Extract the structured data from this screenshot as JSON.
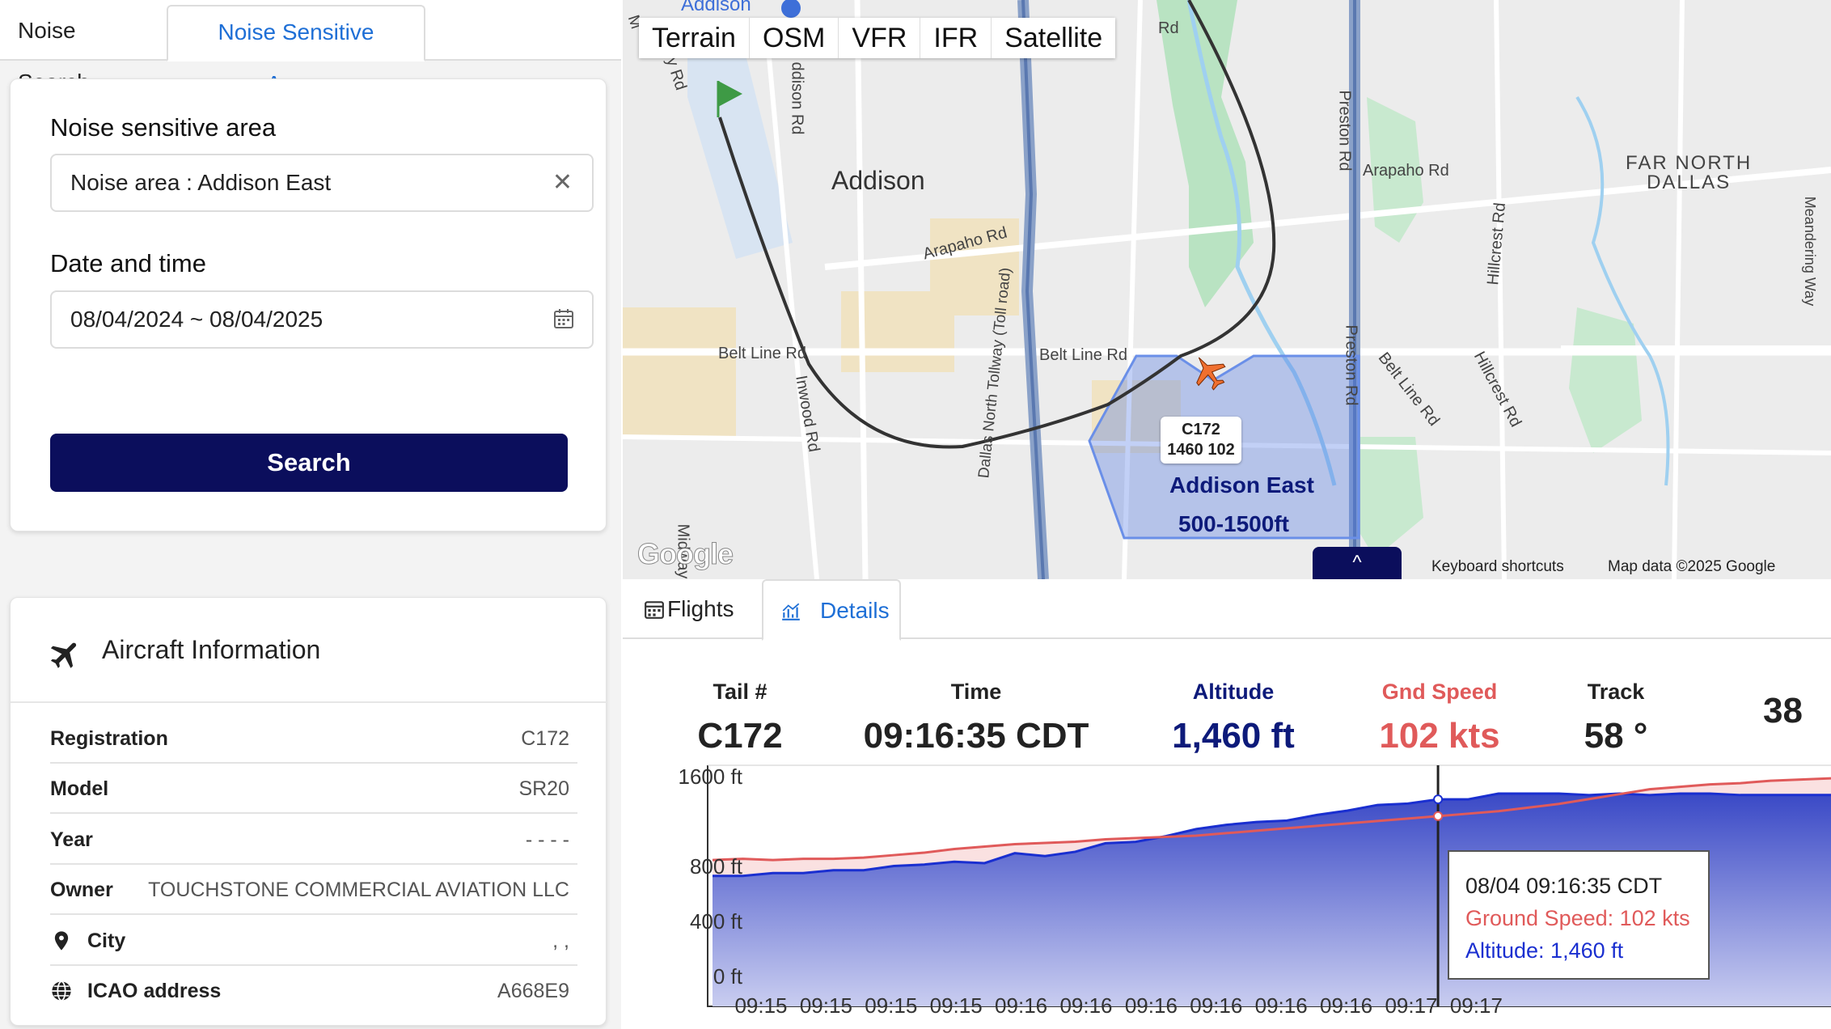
{
  "top_tabs": [
    "Noise Search",
    "Noise Sensitive Areas"
  ],
  "search": {
    "area_label": "Noise sensitive area",
    "area_value": "Noise area : Addison East",
    "date_label": "Date and time",
    "date_value": "08/04/2024 ~ 08/04/2025",
    "button": "Search"
  },
  "aircraft": {
    "title": "Aircraft Information",
    "rows": [
      {
        "k": "Registration",
        "v": "C172"
      },
      {
        "k": "Model",
        "v": "SR20"
      },
      {
        "k": "Year",
        "v": "- - - -"
      },
      {
        "k": "Owner",
        "v": "TOUCHSTONE COMMERCIAL AVIATION LLC"
      },
      {
        "k": "City",
        "v": ", ,"
      },
      {
        "k": "ICAO address",
        "v": "A668E9"
      }
    ]
  },
  "map": {
    "types": [
      "Terrain",
      "OSM",
      "VFR",
      "IFR",
      "Satellite"
    ],
    "labels": {
      "addison_airport": "Addison",
      "addison": "Addison",
      "far_north_dallas_1": "FAR NORTH",
      "far_north_dallas_2": "DALLAS",
      "arapaho_rd_1": "Arapaho Rd",
      "arapaho_rd_2": "Arapaho Rd",
      "belt_line_rd_1": "Belt Line Rd",
      "belt_line_rd_2": "Belt Line Rd",
      "belt_line_rd_3": "Belt Line Rd",
      "preston_rd_1": "Preston Rd",
      "preston_rd_2": "Preston Rd",
      "inwood_rd": "Inwood Rd",
      "addison_rd": "ddison Rd",
      "dallas_tollway_1": "Dallas North Tollway (Toll road)",
      "hillcrest_rd_1": "Hillcrest Rd",
      "hillcrest_rd_2": "Hillcrest Rd",
      "midway_rd": "Midway",
      "meandering_way": "Meandering Way",
      "rd_top": "Rd",
      "rd_top_left": "y Rd",
      "m_top_left": "M"
    },
    "aircraft_tag_1": "C172",
    "aircraft_tag_2": "1460 102",
    "area_name": "Addison East",
    "area_alt": "500-1500ft",
    "keyboard": "Keyboard shortcuts",
    "mapdata": "Map data ©2025 Google",
    "google": "Google",
    "collapse_glyph": "^"
  },
  "detail_tabs": [
    "Flights",
    "Details"
  ],
  "stats": [
    {
      "label": "Tail #",
      "value": "C172"
    },
    {
      "label": "Time",
      "value": "09:16:35 CDT"
    },
    {
      "label": "Altitude",
      "value": "1,460 ft"
    },
    {
      "label": "Gnd Speed",
      "value": "102 kts"
    },
    {
      "label": "Track",
      "value": "58 °"
    },
    {
      "label": "",
      "value": "38"
    }
  ],
  "tooltip": {
    "time": "08/04 09:16:35 CDT",
    "speed": "Ground Speed: 102 kts",
    "alt": "Altitude: 1,460 ft"
  },
  "chart_data": {
    "type": "area",
    "y_ticks": [
      "1600 ft",
      "800 ft",
      "400 ft",
      "0 ft"
    ],
    "ylim": [
      0,
      1700
    ],
    "x_ticks": [
      "09:15",
      "09:15",
      "09:15",
      "09:15",
      "09:16",
      "09:16",
      "09:16",
      "09:16",
      "09:16",
      "09:16",
      "09:17",
      "09:17"
    ],
    "series": [
      {
        "name": "Altitude",
        "color": "#1a2fd0",
        "values": [
          920,
          920,
          940,
          940,
          960,
          960,
          990,
          1000,
          1020,
          1010,
          1080,
          1060,
          1090,
          1150,
          1160,
          1200,
          1250,
          1280,
          1300,
          1310,
          1350,
          1380,
          1420,
          1430,
          1460,
          1460,
          1500,
          1500,
          1500,
          1490,
          1500,
          1490,
          1500,
          1500,
          1490,
          1490,
          1490,
          1490
        ]
      },
      {
        "name": "Ground Speed",
        "color": "#e05a5a",
        "values": [
          1200,
          1210,
          1200,
          1210,
          1210,
          1220,
          1240,
          1260,
          1290,
          1310,
          1330,
          1340,
          1350,
          1370,
          1380,
          1390,
          1400,
          1420,
          1440,
          1460,
          1480,
          1500,
          1520,
          1540,
          1560,
          1580,
          1600,
          1630,
          1660,
          1700,
          1740,
          1780,
          1800,
          1820,
          1830,
          1850,
          1860,
          1870
        ]
      }
    ],
    "cursor_index": 24
  },
  "colors": {
    "primary": "#0b0e5c",
    "accent": "#1e6fd6",
    "altitude": "#1a2fd0",
    "speed": "#e05a5a"
  }
}
